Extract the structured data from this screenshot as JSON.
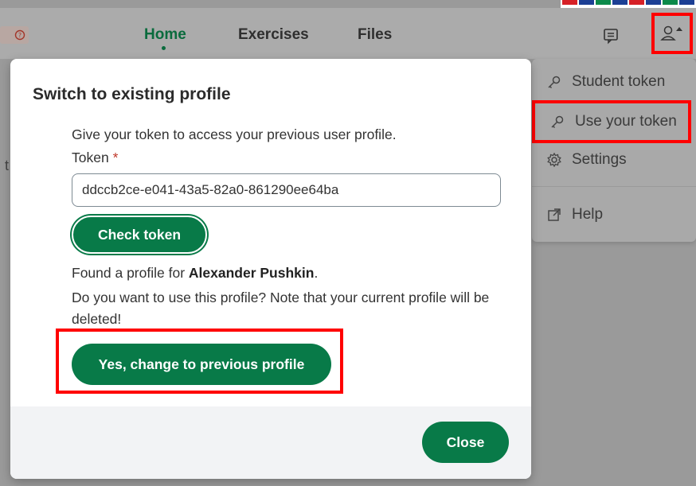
{
  "header": {
    "nav": [
      {
        "label": "Home",
        "active": true
      },
      {
        "label": "Exercises"
      },
      {
        "label": "Files"
      }
    ],
    "left_edge_icons": [
      "play-icon",
      "help-circle-icon"
    ],
    "help_glyph": "⊘⃝",
    "feedback_icon": "message-icon",
    "profile_icon": "user-caret-icon",
    "left_edge_letter": "t"
  },
  "profile_menu": {
    "items": [
      {
        "label": "Student token",
        "icon": "key-icon"
      },
      {
        "label": "Use your token",
        "icon": "key-icon",
        "highlighted": true
      },
      {
        "label": "Settings",
        "icon": "gear-icon"
      },
      {
        "label": "Help",
        "icon": "external-link-icon"
      }
    ]
  },
  "dialog": {
    "title": "Switch to existing profile",
    "intro": "Give your token to access your previous user profile.",
    "token_label": "Token",
    "required_mark": "*",
    "token_value": "ddccb2ce-e041-43a5-82a0-861290ee64ba",
    "check_button": "Check token",
    "found_prefix": "Found a profile for ",
    "found_name": "Alexander Pushkin",
    "found_suffix": ".",
    "question": "Do you want to use this profile? Note that your current profile will be deleted!",
    "confirm_button": "Yes, change to previous profile",
    "close_button": "Close"
  },
  "colors": {
    "primary_green": "#087a48",
    "highlight_red": "#ff0000",
    "overlay_gray": "#9a9a9a"
  }
}
